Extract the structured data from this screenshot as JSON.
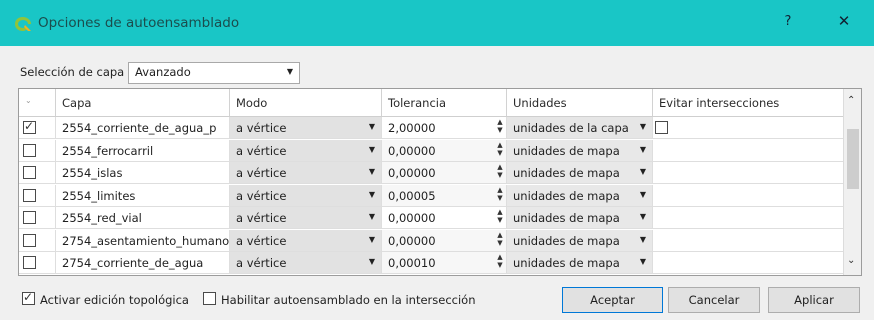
{
  "window": {
    "title": "Opciones de autoensamblado",
    "help_label": "?",
    "close_label": "✕",
    "accent": "#19c6c6"
  },
  "layer_selection": {
    "label": "Selección de capa",
    "value": "Avanzado"
  },
  "table": {
    "columns": [
      "Capa",
      "Modo",
      "Tolerancia",
      "Unidades",
      "Evitar intersecciones"
    ],
    "rows": [
      {
        "checked": true,
        "layer": "2554_corriente_de_agua_p",
        "mode": "a vértice",
        "tolerance": "2,00000",
        "units": "unidades de la capa",
        "avoid": false
      },
      {
        "checked": false,
        "layer": "2554_ferrocarril",
        "mode": "a vértice",
        "tolerance": "0,00000",
        "units": "unidades de mapa"
      },
      {
        "checked": false,
        "layer": "2554_islas",
        "mode": "a vértice",
        "tolerance": "0,00000",
        "units": "unidades de mapa"
      },
      {
        "checked": false,
        "layer": "2554_limites",
        "mode": "a vértice",
        "tolerance": "0,00005",
        "units": "unidades de mapa"
      },
      {
        "checked": false,
        "layer": "2554_red_vial",
        "mode": "a vértice",
        "tolerance": "0,00000",
        "units": "unidades de mapa"
      },
      {
        "checked": false,
        "layer": "2754_asentamiento_humano",
        "mode": "a vértice",
        "tolerance": "0,00000",
        "units": "unidades de mapa"
      },
      {
        "checked": false,
        "layer": "2754_corriente_de_agua",
        "mode": "a vértice",
        "tolerance": "0,00010",
        "units": "unidades de mapa"
      }
    ]
  },
  "options": {
    "topological_editing": {
      "label": "Activar edición topológica",
      "checked": true
    },
    "intersection_snapping": {
      "label": "Habilitar autoensamblado en la intersección",
      "checked": false
    }
  },
  "buttons": {
    "accept": "Aceptar",
    "cancel": "Cancelar",
    "apply": "Aplicar"
  }
}
